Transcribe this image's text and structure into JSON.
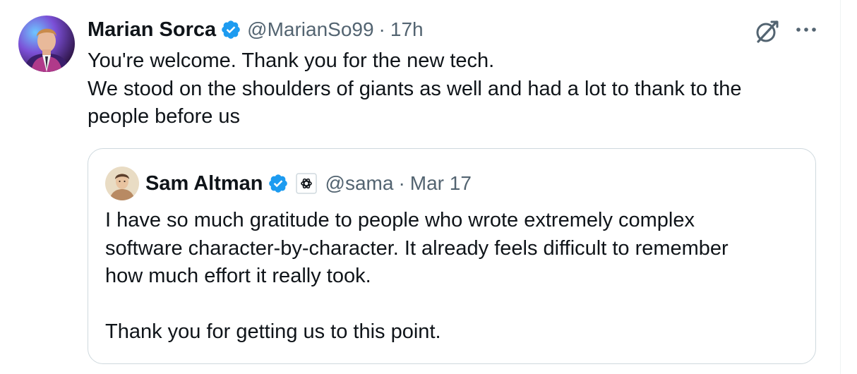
{
  "tweet": {
    "author": {
      "display_name": "Marian Sorca",
      "handle": "@MarianSo99",
      "verified": true
    },
    "separator": "·",
    "time": "17h",
    "text_lines": [
      "You're welcome. Thank you for the new tech.",
      "We stood on the shoulders of giants as well and had a lot to thank to the",
      "people before us"
    ],
    "actions": {
      "grok_icon": "grok-icon",
      "more_icon": "more-dots-icon"
    }
  },
  "quoted_tweet": {
    "author": {
      "display_name": "Sam Altman",
      "handle": "@sama",
      "verified": true,
      "affiliation_icon": "openai-logo-icon"
    },
    "separator": "·",
    "time": "Mar 17",
    "text_lines": [
      "I have so much gratitude to people who wrote extremely complex",
      "software character-by-character. It already feels difficult to remember",
      "how much effort it really took.",
      "",
      "Thank you for getting us to this point."
    ]
  },
  "colors": {
    "verified_blue": "#1d9bf0",
    "secondary_text": "#536471",
    "primary_text": "#0f1419",
    "border": "#cfd9de"
  }
}
